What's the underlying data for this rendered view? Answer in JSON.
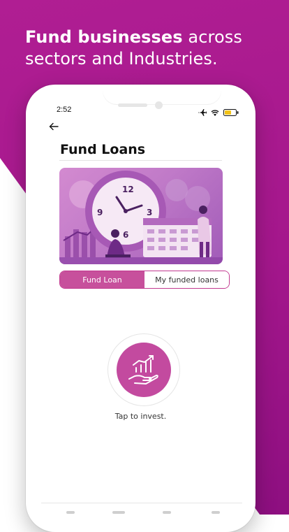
{
  "promo": {
    "headline_bold": "Fund businesses",
    "headline_rest": " across sectors and Industries."
  },
  "status_bar": {
    "time": "2:52",
    "icons": [
      "airplane-icon",
      "wifi-icon",
      "battery-icon"
    ]
  },
  "screen": {
    "title": "Fund Loans",
    "banner_illustration": "clock-calendar-investment-illustration",
    "tabs": [
      {
        "label": "Fund Loan",
        "active": true
      },
      {
        "label": "My funded loans",
        "active": false
      }
    ],
    "invest_button_icon": "hand-growth-chart-icon",
    "invest_caption": "Tap to invest."
  },
  "colors": {
    "brand_magenta": "#a4178c",
    "tab_active": "#c7509c",
    "invest_circle": "#c34a9f"
  }
}
